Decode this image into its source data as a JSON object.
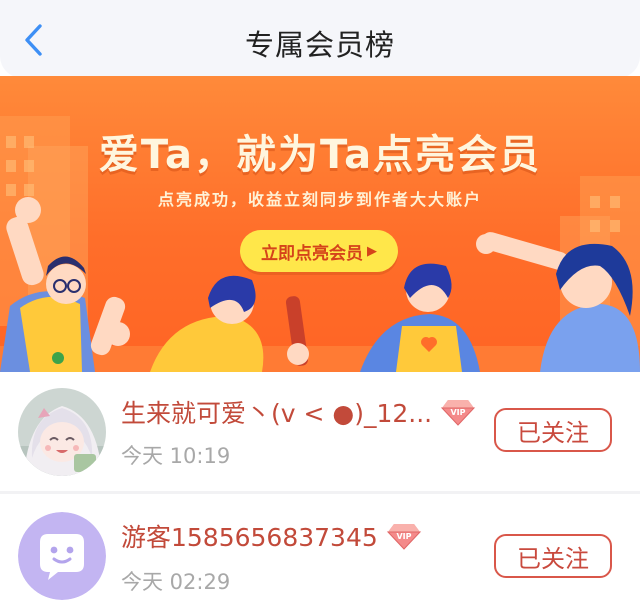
{
  "header": {
    "title": "专属会员榜",
    "back_icon": "chevron-left-icon"
  },
  "banner": {
    "headline": "爱Ta，就为Ta点亮会员",
    "subtitle": "点亮成功，收益立刻同步到作者大大账户",
    "cta_label": "立即点亮会员",
    "cta_icon": "play-triangle-icon",
    "colors": {
      "background": "#ff6e2a",
      "cta": "#ffe74a",
      "cta_text": "#d5431a"
    }
  },
  "members": [
    {
      "nickname": "生来就可爱丶(v < ●)_12...",
      "vip_label": "VIP",
      "time": "今天 10:19",
      "follow_label": "已关注",
      "avatar": "anime-girl-avatar"
    },
    {
      "nickname": "游客1585656837345",
      "vip_label": "VIP",
      "time": "今天 02:29",
      "follow_label": "已关注",
      "avatar": "default-chat-avatar"
    }
  ],
  "colors": {
    "nickname": "#c24a3a",
    "follow_border": "#d9574a",
    "time": "#a8a8a8",
    "back_icon": "#3d8ff5"
  }
}
